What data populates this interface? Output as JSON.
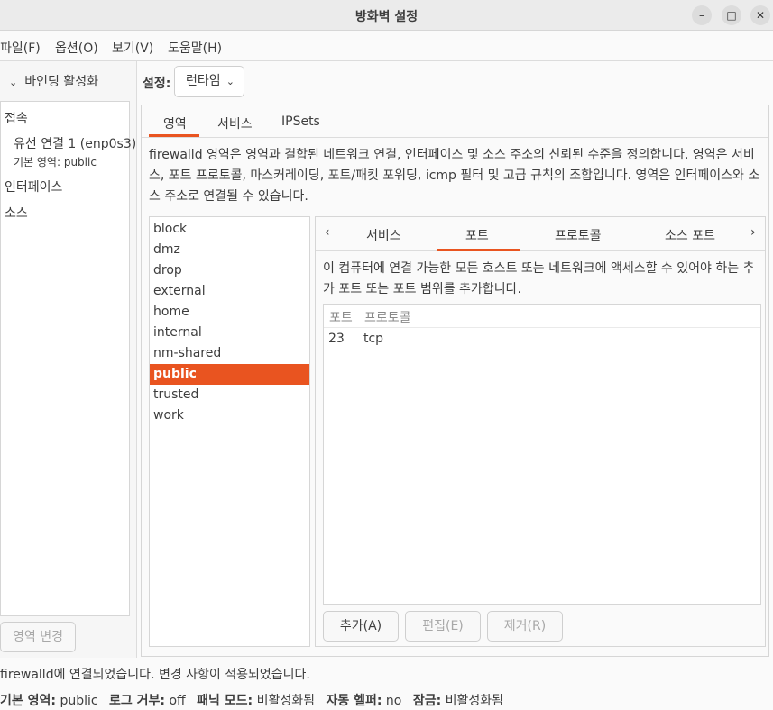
{
  "window": {
    "title": "방화벽 설정",
    "minimize_icon": "minimize-icon",
    "maximize_icon": "maximize-icon",
    "close_icon": "close-icon"
  },
  "menubar": {
    "items": [
      "파일(F)",
      "옵션(O)",
      "보기(V)",
      "도움말(H)"
    ]
  },
  "sidebar": {
    "binding_header": "바인딩 활성화",
    "connections_label": "접속",
    "connection_name": "유선 연결 1 (enp0s3)",
    "connection_zone": "기본 영역: public",
    "interfaces_label": "인터페이스",
    "sources_label": "소스",
    "zone_change_button": "영역 변경"
  },
  "config": {
    "label": "설정:",
    "value": "런타임"
  },
  "main_tabs": [
    "영역",
    "서비스",
    "IPSets"
  ],
  "zone_description": "firewalld 영역은 영역과 결합된 네트워크 연결, 인터페이스 및 소스 주소의 신뢰된 수준을 정의합니다. 영역은 서비스, 포트 프로토콜, 마스커레이딩, 포트/패킷 포워딩, icmp 필터 및 고급 규칙의 조합입니다. 영역은 인터페이스와 소스 주소로 연결될 수 있습니다.",
  "zones": [
    "block",
    "dmz",
    "drop",
    "external",
    "home",
    "internal",
    "nm-shared",
    "public",
    "trusted",
    "work"
  ],
  "selected_zone": "public",
  "sub_tabs": [
    "서비스",
    "포트",
    "프로토콜",
    "소스 포트"
  ],
  "ports": {
    "description": "이 컴퓨터에 연결 가능한 모든 호스트 또는 네트워크에 액세스할 수 있어야 하는 추가 포트 또는 포트 범위를 추가합니다.",
    "columns": [
      "포트",
      "프로토콜"
    ],
    "rows": [
      {
        "port": "23",
        "protocol": "tcp"
      }
    ],
    "add_button": "추가(A)",
    "edit_button": "편집(E)",
    "remove_button": "제거(R)"
  },
  "status": {
    "message": "firewalld에 연결되었습니다. 변경 사항이 적용되었습니다.",
    "default_zone_label": "기본 영역:",
    "default_zone_value": "public",
    "log_denied_label": "로그 거부:",
    "log_denied_value": "off",
    "panic_label": "패닉 모드:",
    "panic_value": "비활성화됨",
    "helper_label": "자동 헬퍼:",
    "helper_value": "no",
    "lockdown_label": "잠금:",
    "lockdown_value": "비활성화됨"
  },
  "colors": {
    "accent": "#e95420",
    "selected_text": "#ffffff"
  }
}
